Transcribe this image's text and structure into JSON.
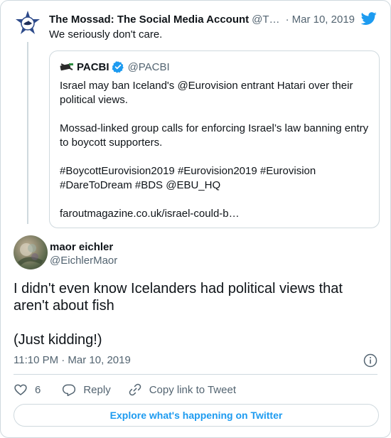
{
  "parent_tweet": {
    "author_name": "The Mossad: The Social Media Account",
    "author_handle": "@TheMossad",
    "separator": "·",
    "date": "Mar 10, 2019",
    "text": "We seriously don't care."
  },
  "quoted_tweet": {
    "author_name": "PACBI",
    "author_handle": "@PACBI",
    "paragraphs": [
      "Israel may ban Iceland's @Eurovision entrant Hatari over their political views.",
      "Mossad-linked group calls for enforcing Israel’s law banning entry to boycott supporters.",
      "#BoycottEurovision2019 #Eurovision2019 #Eurovision\n#DareToDream #BDS @EBU_HQ",
      "faroutmagazine.co.uk/israel-could-b…"
    ]
  },
  "reply": {
    "author_name": "maor eichler",
    "author_handle": "@EichlerMaor",
    "paragraphs": [
      "I didn't even know Icelanders had political views that aren't about fish",
      "(Just kidding!)"
    ],
    "timestamp": "11:10 PM · Mar 10, 2019"
  },
  "actions": {
    "like_count": "6",
    "reply_label": "Reply",
    "copy_link_label": "Copy link to Tweet"
  },
  "explore_label": "Explore what's happening on Twitter",
  "colors": {
    "accent": "#1d9bf0",
    "text": "#0f1419",
    "secondary": "#536471",
    "border": "#cfd9de"
  },
  "icons": [
    "mossad-emblem-icon",
    "twitter-bird-icon",
    "pacbi-logo-icon",
    "verified-badge-icon",
    "info-icon",
    "heart-icon",
    "reply-icon",
    "link-icon"
  ]
}
